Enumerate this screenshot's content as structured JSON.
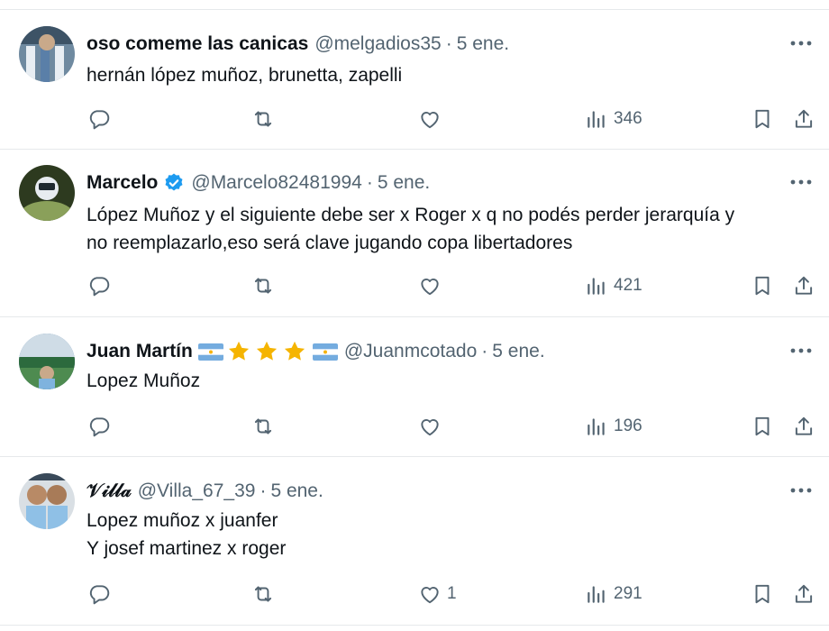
{
  "colors": {
    "text": "#0f1419",
    "muted": "#536471",
    "divider": "#e6e9eb",
    "verified": "#1d9bf0",
    "star": "#f5b400"
  },
  "tweets": [
    {
      "name": "oso comeme las canicas",
      "handle": "@melgadios35",
      "separator": "·",
      "date": "5 ene.",
      "lines": [
        "hernán lópez muñoz, brunetta, zapelli"
      ],
      "likes": "",
      "views": "346"
    },
    {
      "name": "Marcelo",
      "verified": true,
      "handle": "@Marcelo82481994",
      "separator": "·",
      "date": "5 ene.",
      "lines": [
        "López Muñoz y el siguiente debe ser x Roger x q no podés perder jerarquía y",
        "no reemplazarlo,eso será clave jugando copa libertadores"
      ],
      "likes": "",
      "views": "421"
    },
    {
      "name": "Juan Martín",
      "name_emoji": [
        "flag-argentina",
        "star",
        "star",
        "star",
        "flag-argentina"
      ],
      "handle": "@Juanmcotado",
      "separator": "·",
      "date": "5 ene.",
      "lines": [
        "Lopez Muñoz"
      ],
      "likes": "",
      "views": "196"
    },
    {
      "name": "𝒱𝒾𝓁𝓁𝒶",
      "handle": "@Villa_67_39",
      "separator": "·",
      "date": "5 ene.",
      "lines": [
        "Lopez muñoz x juanfer",
        "Y josef martinez x roger"
      ],
      "likes": "1",
      "views": "291"
    }
  ],
  "icons": {
    "reply": "reply-icon",
    "retweet": "retweet-icon",
    "like": "like-icon",
    "views": "views-icon",
    "bookmark": "bookmark-icon",
    "share": "share-icon",
    "more": "more-icon"
  }
}
